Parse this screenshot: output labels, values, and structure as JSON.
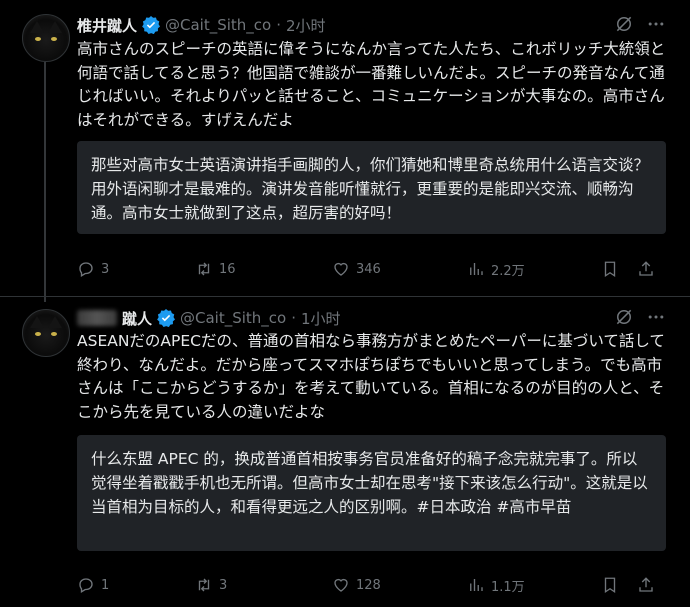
{
  "tweets": [
    {
      "author": {
        "name": "椎井蹴人",
        "handle": "@Cait_Sith_co"
      },
      "time": "2小时",
      "text": "高市さんのスピーチの英語に偉そうになんか言ってた人たち、これボリッチ大統領と何語で話してると思う？他国語で雑談が一番難しいんだよ。スピーチの発音なんて通じればいい。それよりパッと話せること、コミュニケーションが大事なの。高市さんはそれができる。すげえんだよ",
      "translation": "那些对高市女士英语演讲指手画脚的人，你们猜她和博里奇总统用什么语言交谈？用外语闲聊才是最难的。演讲发音能听懂就行，更重要的是能即兴交流、顺畅沟通。高市女士就做到了这点，超厉害的好吗！",
      "stats": {
        "replies": "3",
        "reposts": "16",
        "likes": "346",
        "views": "2.2万"
      }
    },
    {
      "author": {
        "name": "蹴人",
        "handle": "@Cait_Sith_co"
      },
      "time": "1小时",
      "text": "ASEANだのAPECだの、普通の首相なら事務方がまとめたペーパーに基づいて話して終わり、なんだよ。だから座ってスマホぽちぽちでもいいと思ってしまう。でも高市さんは「ここからどうするか」を考えて動いている。首相になるのが目的の人と、そこから先を見ている人の違いだよな",
      "translation": "什么东盟 APEC 的，换成普通首相按事务官员准备好的稿子念完就完事了。所以觉得坐着戳戳手机也无所谓。但高市女士却在思考\"接下来该怎么行动\"。这就是以当首相为目标的人，和看得更远之人的区别啊。#日本政治 #高市早苗",
      "stats": {
        "replies": "1",
        "reposts": "3",
        "likes": "128",
        "views": "1.1万"
      }
    }
  ],
  "separator": "·",
  "colors": {
    "background": "#000000",
    "text": "#e7e9ea",
    "muted": "#71767b",
    "verified": "#1d9bf0",
    "translation_bg": "#202327"
  }
}
